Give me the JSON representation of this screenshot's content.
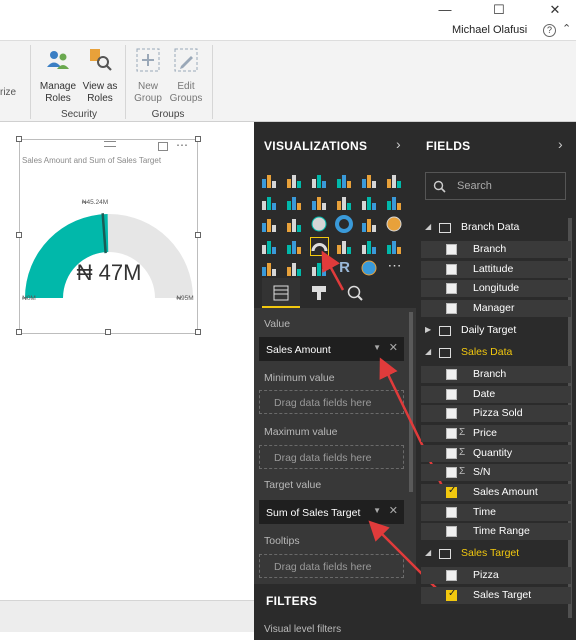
{
  "window": {
    "minimize": "—",
    "maximize": "☐",
    "close": "✕",
    "user": "Michael Olafusi",
    "help": "?"
  },
  "ribbon": {
    "cut_text": "rize",
    "manage_roles": [
      "Manage",
      "Roles"
    ],
    "view_as_roles": [
      "View as",
      "Roles"
    ],
    "security_label": "Security",
    "new_group": [
      "New",
      "Group"
    ],
    "edit_groups": [
      "Edit",
      "Groups"
    ],
    "groups_label": "Groups"
  },
  "visual": {
    "title": "Sales Amount and Sum of Sales Target",
    "value_text": "₦ 47M",
    "target_text": "₦45.24M",
    "min_text": "₦0M",
    "max_text": "₦95M",
    "value": 47,
    "target": 45.24,
    "min": 0,
    "max": 95,
    "fill_color": "#01b8aa",
    "track_color": "#e6e6e6",
    "target_color": "#1a5c55"
  },
  "visualizations": {
    "title": "VISUALIZATIONS",
    "chevron": "›",
    "selected_icon": "gauge-icon",
    "wells": {
      "value_label": "Value",
      "value_field": "Sales Amount",
      "min_label": "Minimum value",
      "min_placeholder": "Drag data fields here",
      "max_label": "Maximum value",
      "max_placeholder": "Drag data fields here",
      "target_label": "Target value",
      "target_field": "Sum of Sales Target",
      "tooltips_label": "Tooltips",
      "tooltips_placeholder": "Drag data fields here"
    },
    "filters_title": "FILTERS",
    "visual_filters": "Visual level filters"
  },
  "fields": {
    "title": "FIELDS",
    "chevron": "›",
    "search_placeholder": "Search",
    "tables": [
      {
        "name": "Branch Data",
        "active": false,
        "fields": [
          {
            "name": "Branch",
            "sigma": false,
            "checked": false
          },
          {
            "name": "Lattitude",
            "sigma": false,
            "checked": false
          },
          {
            "name": "Longitude",
            "sigma": false,
            "checked": false
          },
          {
            "name": "Manager",
            "sigma": false,
            "checked": false
          }
        ]
      },
      {
        "name": "Daily Target",
        "active": false,
        "collapsed": true,
        "fields": []
      },
      {
        "name": "Sales Data",
        "active": true,
        "fields": [
          {
            "name": "Branch",
            "sigma": false,
            "checked": false
          },
          {
            "name": "Date",
            "sigma": false,
            "checked": false
          },
          {
            "name": "Pizza Sold",
            "sigma": false,
            "checked": false
          },
          {
            "name": "Price",
            "sigma": true,
            "checked": false
          },
          {
            "name": "Quantity",
            "sigma": true,
            "checked": false
          },
          {
            "name": "S/N",
            "sigma": true,
            "checked": false
          },
          {
            "name": "Sales Amount",
            "sigma": false,
            "checked": true
          },
          {
            "name": "Time",
            "sigma": false,
            "checked": false
          },
          {
            "name": "Time Range",
            "sigma": false,
            "checked": false
          }
        ]
      },
      {
        "name": "Sales Target",
        "active": true,
        "fields": [
          {
            "name": "Pizza",
            "sigma": false,
            "checked": false
          },
          {
            "name": "Sales Target",
            "sigma": false,
            "checked": true
          }
        ]
      }
    ]
  }
}
